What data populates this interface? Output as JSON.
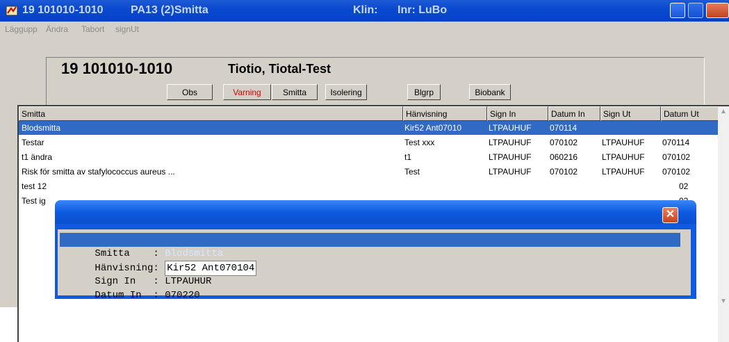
{
  "window": {
    "title_id": "19 101010-1010",
    "title_module": "PA13 (2)Smitta",
    "title_klin": "Klin:",
    "title_inr": "Inr: LuBo"
  },
  "menu": {
    "items": [
      "Läggupp",
      "Ändra",
      "Tabort",
      "signUt"
    ]
  },
  "patient": {
    "id": "19 101010-1010",
    "name": "Tiotio, Tiotal-Test"
  },
  "tabs": [
    "Obs",
    "Varning",
    "Smitta",
    "Isolering",
    "Blgrp",
    "Biobank"
  ],
  "table": {
    "headers": [
      "Smitta",
      "Hänvisning",
      "Sign In",
      "Datum In",
      "Sign Ut",
      "Datum Ut"
    ],
    "rows": [
      [
        "Blodsmitta",
        "Kir52 Ant07010",
        "LTPAUHUF",
        "070114",
        "",
        ""
      ],
      [
        "Testar",
        "Test xxx",
        "LTPAUHUF",
        "070102",
        "LTPAUHUF",
        "070114"
      ],
      [
        "t1  ändra",
        "t1",
        "LTPAUHUF",
        "060216",
        "LTPAUHUF",
        "070102"
      ],
      [
        "Risk för smitta av stafylococcus aureus ...",
        "Test",
        "LTPAUHUF",
        "070102",
        "LTPAUHUF",
        "070102"
      ],
      [
        "test 12",
        "",
        "",
        "",
        "",
        "02"
      ],
      [
        "Test ig",
        "",
        "",
        "",
        "",
        "02"
      ]
    ]
  },
  "popup": {
    "lines": [
      {
        "label": "Smitta    : ",
        "value": "Blodsmitta"
      },
      {
        "label": "Hänvisning: ",
        "value": "Kir52 Ant070104"
      },
      {
        "label": "Sign In   : ",
        "value": "LTPAUHUR"
      },
      {
        "label": "Datum In  : ",
        "value": "070220"
      }
    ]
  },
  "colors": {
    "titlebar": "#0a4ad0",
    "selection": "#316ac5",
    "face": "#d4d0c8",
    "warning_text": "#d00000"
  }
}
